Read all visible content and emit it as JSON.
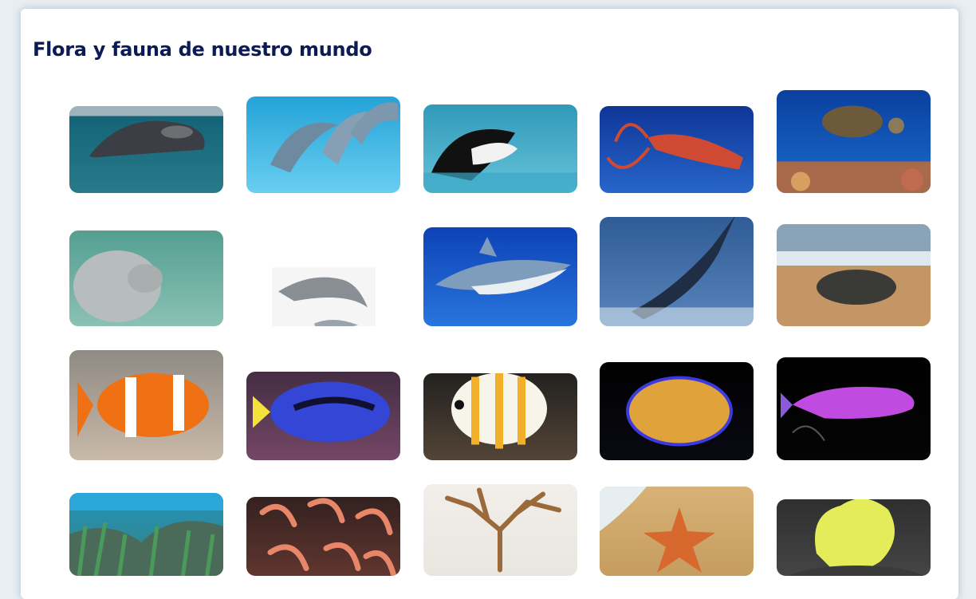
{
  "page": {
    "title": "Flora y fauna de nuestro mundo"
  },
  "gallery": [
    {
      "name": "right-whale-image",
      "caption": "",
      "scene": "whale",
      "bg1": "#0f5e72",
      "bg2": "#2b7d8d",
      "fg": "#3b3e44"
    },
    {
      "name": "dolphins-image",
      "caption": "",
      "scene": "dolphins",
      "bg1": "#1e9fd6",
      "bg2": "#6fd2f2",
      "fg": "#6d8aa1"
    },
    {
      "name": "orca-image",
      "caption": "",
      "scene": "orca",
      "bg1": "#2a93b5",
      "bg2": "#6cc9dd",
      "fg": "#111111"
    },
    {
      "name": "giant-squid-image",
      "caption": "",
      "scene": "squid",
      "bg1": "#0a2f8f",
      "bg2": "#2b6cd1",
      "fg": "#cf4a33"
    },
    {
      "name": "sea-turtle-reef-image",
      "caption": "",
      "scene": "turtle",
      "bg1": "#0a3d9c",
      "bg2": "#1b6fcf",
      "fg": "#6c5a3a"
    },
    {
      "name": "manatee-image",
      "caption": "",
      "scene": "manatee",
      "bg1": "#4f9c8f",
      "bg2": "#8fc4b7",
      "fg": "#b7bcbc"
    },
    {
      "name": "risso-dolphin-illustration",
      "caption": "",
      "scene": "drawing",
      "bg1": "#ffffff",
      "bg2": "#f2f2f2",
      "fg": "#8a8f95"
    },
    {
      "name": "great-white-shark-image",
      "caption": "",
      "scene": "shark",
      "bg1": "#0b3fb3",
      "bg2": "#2b78e0",
      "fg": "#7e9cbc"
    },
    {
      "name": "marlin-image",
      "caption": "",
      "scene": "marlin",
      "bg1": "#2f5b96",
      "bg2": "#5a85bb",
      "fg": "#1f2d45"
    },
    {
      "name": "leatherback-turtle-beach-image",
      "caption": "",
      "scene": "beach",
      "bg1": "#8fa6b9",
      "bg2": "#c2966a",
      "fg": "#3a3a36"
    },
    {
      "name": "clownfish-image",
      "caption": "",
      "scene": "clownfish",
      "bg1": "#8f8a84",
      "bg2": "#c9b9a8",
      "fg": "#f07014"
    },
    {
      "name": "blue-tang-image",
      "caption": "",
      "scene": "bluetang",
      "bg1": "#3e2a3e",
      "bg2": "#7a4a6a",
      "fg": "#3346d6"
    },
    {
      "name": "butterflyfish-image",
      "caption": "",
      "scene": "butterfly",
      "bg1": "#1c1c1c",
      "bg2": "#5a4a3a",
      "fg": "#f2b02a"
    },
    {
      "name": "angelfish-image",
      "caption": "",
      "scene": "angelfish",
      "bg1": "#000000",
      "bg2": "#0a0a14",
      "fg": "#e0a23a"
    },
    {
      "name": "dottyback-image",
      "caption": "",
      "scene": "dottyback",
      "bg1": "#000000",
      "bg2": "#050505",
      "fg": "#c04be0"
    },
    {
      "name": "seagrass-reef-image",
      "caption": "",
      "scene": "seagrass",
      "bg1": "#1e96c7",
      "bg2": "#3c7f70",
      "fg": "#4a9a5a"
    },
    {
      "name": "shrimp-image",
      "caption": "",
      "scene": "shrimp",
      "bg1": "#2a1d1d",
      "bg2": "#6a3a32",
      "fg": "#e8866a"
    },
    {
      "name": "seaweed-specimen-image",
      "caption": "",
      "scene": "seaweed",
      "bg1": "#f3f0ec",
      "bg2": "#e8e4de",
      "fg": "#9a6a3a"
    },
    {
      "name": "starfish-sand-image",
      "caption": "",
      "scene": "starfish",
      "bg1": "#d9b47a",
      "bg2": "#c49a5c",
      "fg": "#d8692e"
    },
    {
      "name": "yellow-sponge-image",
      "caption": "",
      "scene": "sponge",
      "bg1": "#2a2a2a",
      "bg2": "#4a4a4a",
      "fg": "#e4ec5a"
    }
  ]
}
